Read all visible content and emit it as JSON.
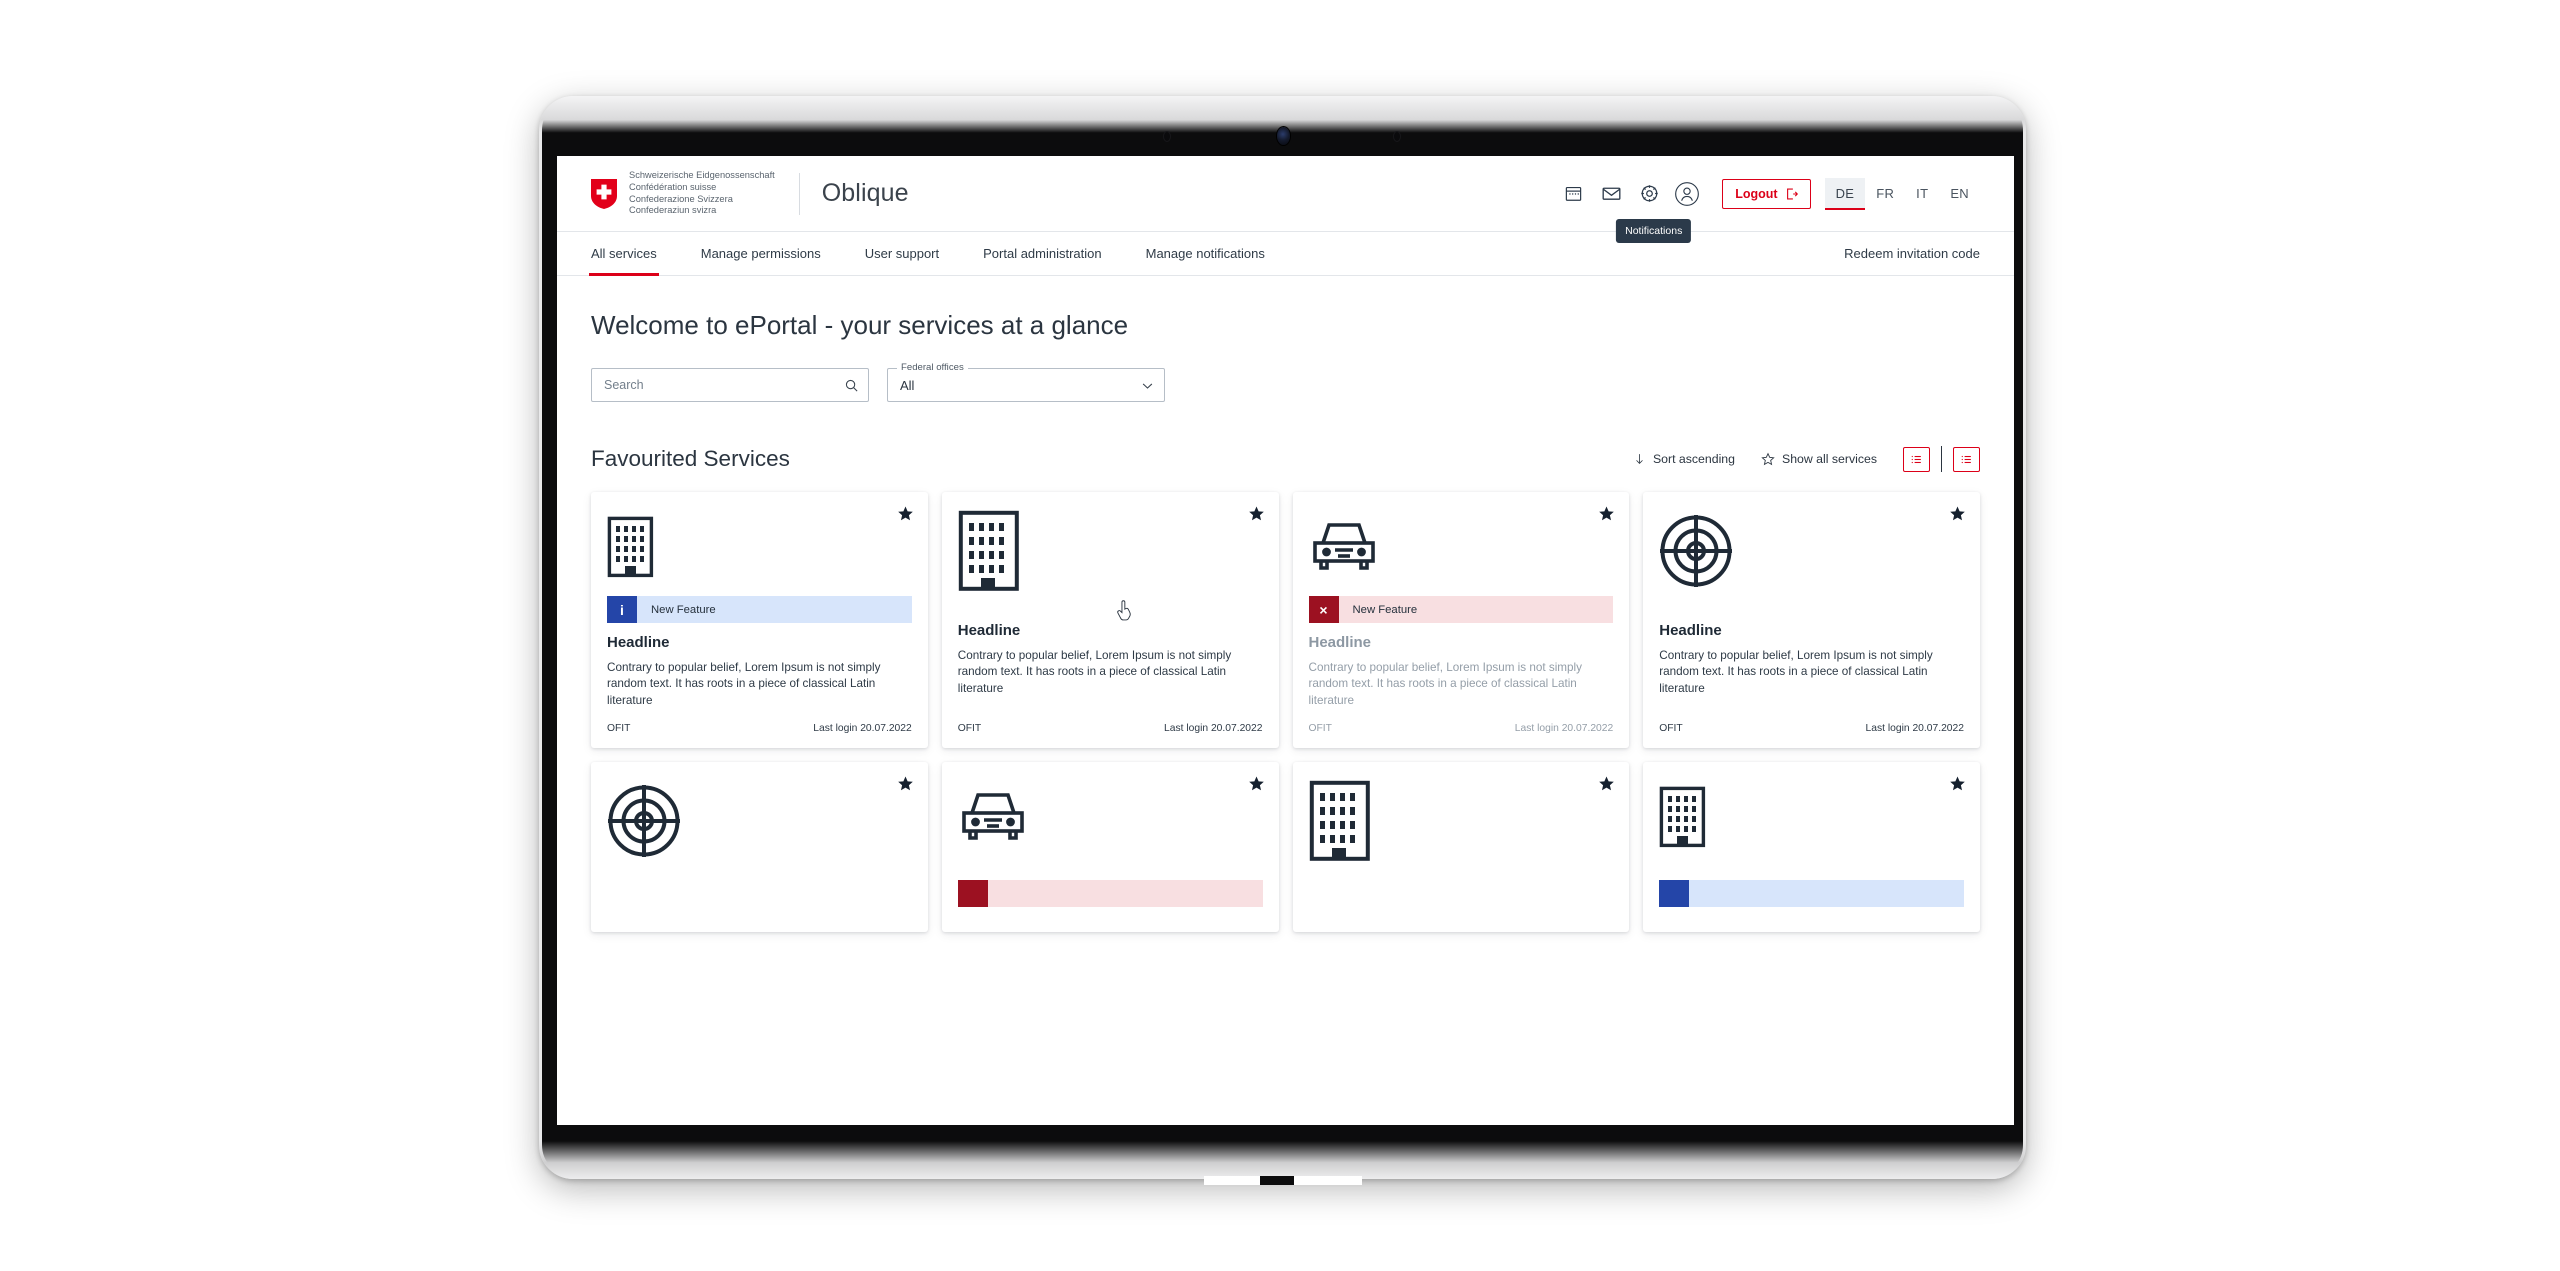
{
  "brand": {
    "logo_icon": "swiss-cross-shield-icon",
    "lines": [
      "Schweizerische Eidgenossenschaft",
      "Confédération suisse",
      "Confederazione Svizzera",
      "Confederaziun svizra"
    ],
    "app_title": "Oblique"
  },
  "header": {
    "icons": [
      {
        "name": "calendar-icon",
        "label": "Calendar"
      },
      {
        "name": "inbox-icon",
        "label": "Inbox"
      },
      {
        "name": "gear-icon",
        "label": "Settings"
      },
      {
        "name": "user-avatar-icon",
        "label": "Profile"
      }
    ],
    "tooltip": "Notifications",
    "logout_label": "Logout",
    "logout_icon": "logout-arrow-icon",
    "languages": [
      "DE",
      "FR",
      "IT",
      "EN"
    ],
    "active_language": "DE"
  },
  "nav": {
    "items": [
      "All services",
      "Manage permissions",
      "User support",
      "Portal administration",
      "Manage notifications"
    ],
    "active": "All services",
    "right_item": "Redeem invitation code"
  },
  "main": {
    "page_title": "Welcome to ePortal - your services at a glance",
    "search": {
      "placeholder": "Search",
      "value": "",
      "icon": "search-icon"
    },
    "office_select": {
      "label": "Federal offices",
      "value": "All",
      "icon": "chevron-down-icon"
    },
    "section_title": "Favourited Services",
    "sort_label": "Sort ascending",
    "sort_icon": "arrow-down-icon",
    "show_all_label": "Show all services",
    "show_all_icon": "star-outline-icon",
    "view_toggles": [
      {
        "name": "list-view-compact-button",
        "icon": "list-icon"
      },
      {
        "name": "list-view-detailed-button",
        "icon": "list-icon"
      }
    ]
  },
  "colors": {
    "accent_red": "#dc0018",
    "info_blue": "#2445a8",
    "info_blue_bg": "#d7e5fb",
    "error_red": "#9c1121",
    "error_red_bg": "#f8dfe1",
    "text_dark": "#1f2a36",
    "tooltip_bg": "#2b3a4a"
  },
  "cards": [
    {
      "icon": "building-icon",
      "starred": true,
      "badge": {
        "type": "info",
        "mark": "i",
        "text": "New Feature"
      },
      "headline": "Headline",
      "body": "Contrary to popular belief, Lorem Ipsum is not simply random text. It has roots in a piece of classical Latin literature",
      "office": "OFIT",
      "last_login": "Last login 20.07.2022",
      "disabled": false
    },
    {
      "icon": "building-icon",
      "starred": true,
      "badge": null,
      "headline": "Headline",
      "body": "Contrary to popular belief, Lorem Ipsum is not simply random text. It has roots in a piece of classical Latin literature",
      "office": "OFIT",
      "last_login": "Last login 20.07.2022",
      "disabled": false
    },
    {
      "icon": "car-icon",
      "starred": true,
      "badge": {
        "type": "error",
        "mark": "×",
        "text": "New Feature"
      },
      "headline": "Headline",
      "body": "Contrary to popular belief, Lorem Ipsum is not simply random text. It has roots in a piece of classical Latin literature",
      "office": "OFIT",
      "last_login": "Last login 20.07.2022",
      "disabled": true
    },
    {
      "icon": "target-icon",
      "starred": true,
      "badge": null,
      "headline": "Headline",
      "body": "Contrary to popular belief, Lorem Ipsum is not simply random text. It has roots in a piece of classical Latin literature",
      "office": "OFIT",
      "last_login": "Last login 20.07.2022",
      "disabled": false
    }
  ],
  "cards_row2": [
    {
      "icon": "target-icon",
      "starred": true,
      "badge": null
    },
    {
      "icon": "car-icon",
      "starred": true,
      "badge": {
        "type": "error"
      }
    },
    {
      "icon": "building-icon",
      "starred": true,
      "badge": null
    },
    {
      "icon": "building-icon",
      "starred": true,
      "badge": {
        "type": "info"
      }
    }
  ]
}
